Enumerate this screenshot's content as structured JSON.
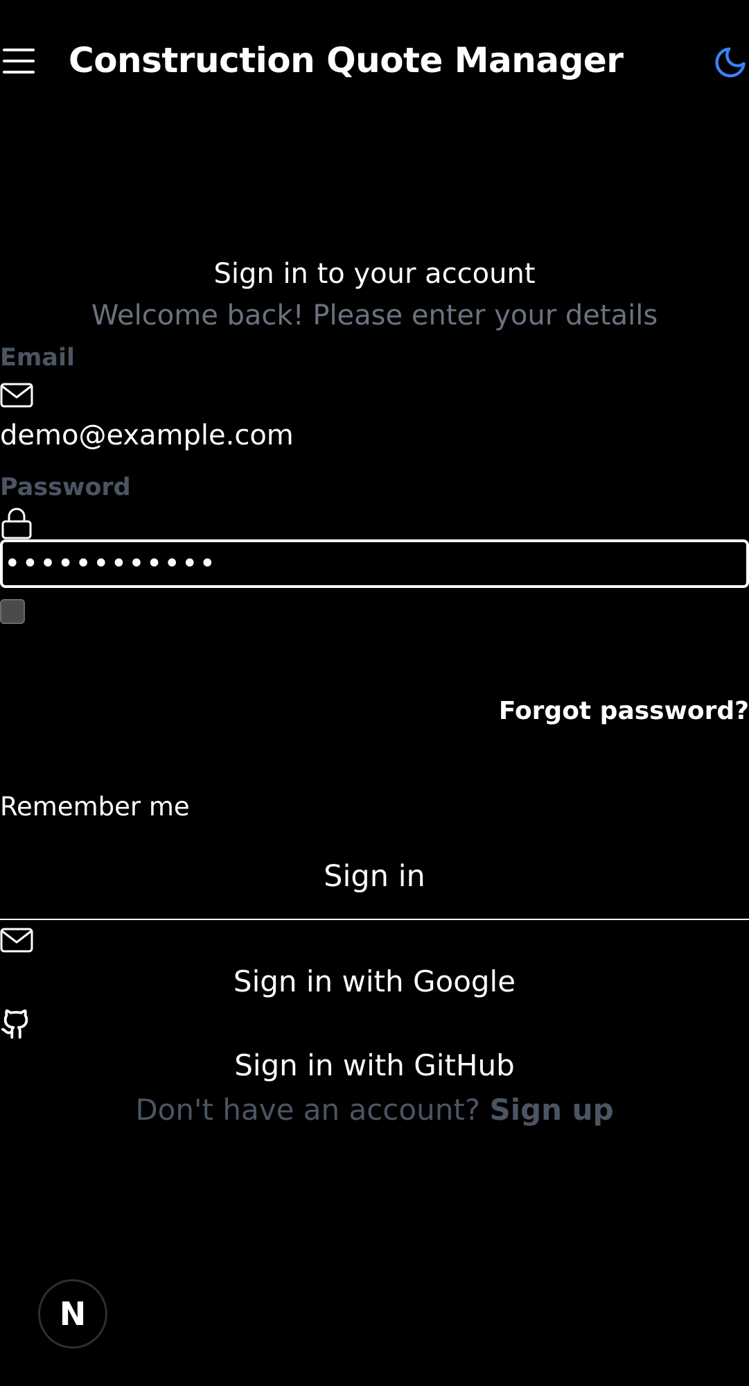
{
  "header": {
    "title": "Construction Quote Manager",
    "menu_icon": "hamburger-menu-icon",
    "theme_icon": "moon-icon",
    "theme_icon_color": "#3b82f6"
  },
  "auth": {
    "heading": "Sign in to your account",
    "subheading": "Welcome back! Please enter your details",
    "email_label": "Email",
    "email_value": "demo@example.com",
    "password_label": "Password",
    "password_value": "••••••••••••",
    "remember_label": "Remember me",
    "forgot_label": "Forgot password?",
    "signin_label": "Sign in",
    "google_label": "Sign in with Google",
    "github_label": "Sign in with GitHub",
    "no_account_text": "Don't have an account?",
    "signup_label": "Sign up"
  },
  "badge": {
    "letter": "N"
  },
  "colors": {
    "background": "#000000",
    "text": "#ffffff",
    "muted": "#6b7280",
    "label": "#4b5563"
  }
}
